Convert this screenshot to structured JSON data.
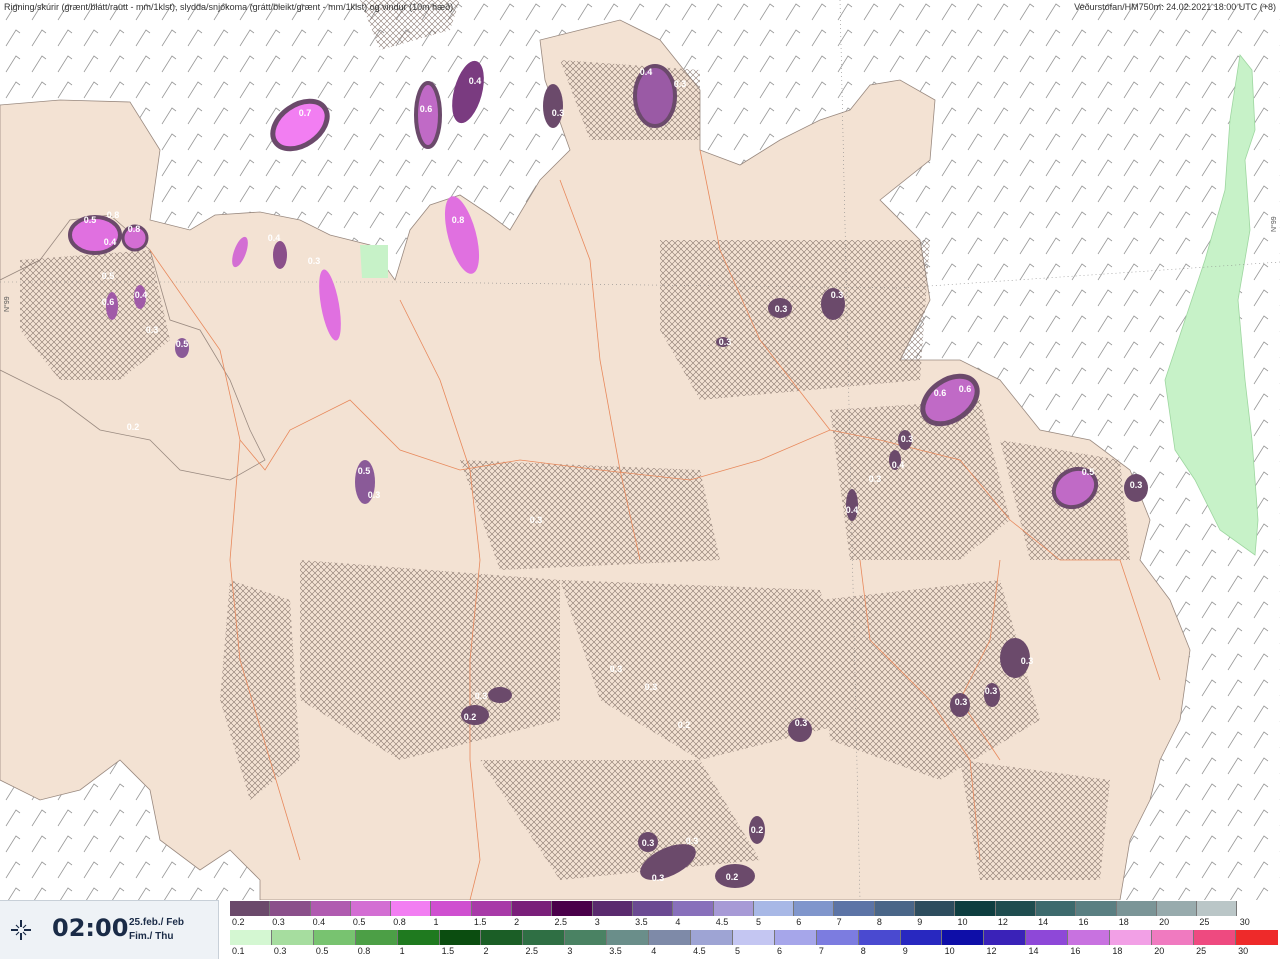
{
  "header": {
    "left": "Rigning/skúrir (grænt/blátt/rautt - mm/1klst), slydda/snjókoma (grátt/bleikt/grænt - mm/1klst) og vindur (10m hæð)",
    "right": "Veðurstofan/HM750m: 24.02.2021 18:00 UTC (+8)"
  },
  "grid_labels": [
    "N°99",
    "N°99"
  ],
  "time": {
    "value": "02:00",
    "date_line1": "25.feb./ Feb",
    "date_line2": "Fim./ Thu",
    "icon": "crosshair-icon"
  },
  "legend": {
    "snow": {
      "labels": [
        "0.2",
        "0.3",
        "0.4",
        "0.5",
        "0.8",
        "1",
        "1.5",
        "2",
        "2.5",
        "3",
        "3.5",
        "4",
        "4.5",
        "5",
        "6",
        "7",
        "8",
        "9",
        "10",
        "12",
        "14",
        "16",
        "18",
        "20",
        "25",
        "30"
      ],
      "colors": [
        "#6b4a6b",
        "#8a4f8a",
        "#b05bb0",
        "#d36ed3",
        "#f27ef2",
        "#cf4fd0",
        "#a83aa8",
        "#7a1f7a",
        "#4a004a",
        "#5a2a6e",
        "#6b4a92",
        "#8870bb",
        "#a79ad6",
        "#a8b8e6",
        "#8096cc",
        "#5c74a6",
        "#4a6688",
        "#2e4d5e",
        "#0e3e40",
        "#1f4d4f",
        "#3d6a6d",
        "#5a7f82",
        "#7b9597",
        "#98abad",
        "#bac6c7",
        "#ffffff"
      ]
    },
    "rain": {
      "labels": [
        "0.1",
        "0.3",
        "0.5",
        "0.8",
        "1",
        "1.5",
        "2",
        "2.5",
        "3",
        "3.5",
        "4",
        "4.5",
        "5",
        "6",
        "7",
        "8",
        "9",
        "10",
        "12",
        "14",
        "16",
        "18",
        "20",
        "25",
        "30"
      ],
      "colors": [
        "#d4f7d2",
        "#a6dd9f",
        "#78c370",
        "#4c9f46",
        "#1f7a1f",
        "#0b4d10",
        "#1b5e26",
        "#2f6f44",
        "#4a8263",
        "#6a8e8a",
        "#7e8aa8",
        "#9ea4d4",
        "#c4c6f2",
        "#a6a6ea",
        "#7c7ce0",
        "#4a4ad0",
        "#2828c0",
        "#0e0ea8",
        "#3a22b8",
        "#8e48d8",
        "#c872e0",
        "#f2a0e6",
        "#f07ac0",
        "#ee4a80",
        "#ee2a2a"
      ]
    }
  },
  "precip_labels": [
    {
      "text": "0.7"
    },
    {
      "text": "0.6"
    },
    {
      "text": "0.4"
    },
    {
      "text": "0.3"
    },
    {
      "text": "0.4"
    },
    {
      "text": "0.3"
    },
    {
      "text": "0.5"
    },
    {
      "text": "0.8"
    },
    {
      "text": "0.8"
    },
    {
      "text": "0.4"
    },
    {
      "text": "0.5"
    },
    {
      "text": "0.6"
    },
    {
      "text": "0.4"
    },
    {
      "text": "0.5"
    },
    {
      "text": "0.3"
    },
    {
      "text": "0.8"
    },
    {
      "text": "0.4"
    },
    {
      "text": "0.3"
    },
    {
      "text": "0.3"
    },
    {
      "text": "0.3"
    },
    {
      "text": "0.5"
    },
    {
      "text": "0.3"
    },
    {
      "text": "0.2"
    },
    {
      "text": "0.3"
    },
    {
      "text": "0.4"
    },
    {
      "text": "0.6"
    },
    {
      "text": "0.6"
    },
    {
      "text": "0.3"
    },
    {
      "text": "0.3"
    },
    {
      "text": "0.4"
    },
    {
      "text": "0.3"
    },
    {
      "text": "0.5"
    },
    {
      "text": "0.3"
    },
    {
      "text": "0.3"
    },
    {
      "text": "0.3"
    },
    {
      "text": "0.3"
    },
    {
      "text": "0.3"
    },
    {
      "text": "0.3"
    },
    {
      "text": "0.3"
    },
    {
      "text": "0.2"
    },
    {
      "text": "0.2"
    },
    {
      "text": "0.3"
    },
    {
      "text": "0.3"
    },
    {
      "text": "0.3"
    },
    {
      "text": "0.2"
    },
    {
      "text": "0.3"
    },
    {
      "text": "0.2"
    }
  ],
  "colors": {
    "land": "#f3e2d3",
    "sea": "#ffffff",
    "roads": "#e8895c",
    "rain_green": "#c7f2c8",
    "hatch": "#7c6a62"
  }
}
